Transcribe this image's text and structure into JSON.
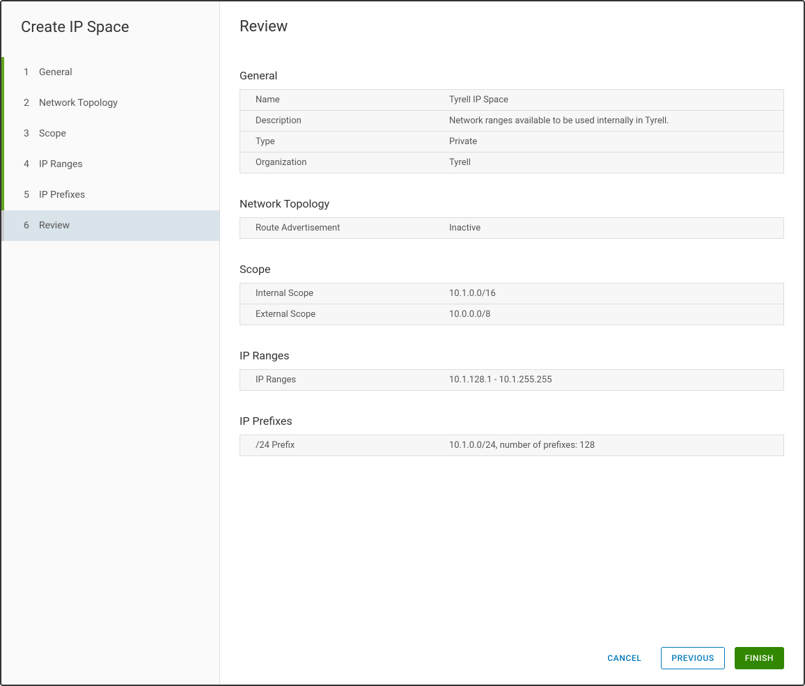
{
  "sidebar": {
    "title": "Create IP Space",
    "steps": [
      {
        "num": "1",
        "label": "General"
      },
      {
        "num": "2",
        "label": "Network Topology"
      },
      {
        "num": "3",
        "label": "Scope"
      },
      {
        "num": "4",
        "label": "IP Ranges"
      },
      {
        "num": "5",
        "label": "IP Prefixes"
      },
      {
        "num": "6",
        "label": "Review"
      }
    ]
  },
  "main": {
    "title": "Review",
    "sections": {
      "general": {
        "title": "General",
        "rows": [
          {
            "key": "Name",
            "value": "Tyrell IP Space"
          },
          {
            "key": "Description",
            "value": "Network ranges available to be used internally in Tyrell."
          },
          {
            "key": "Type",
            "value": "Private"
          },
          {
            "key": "Organization",
            "value": "Tyrell"
          }
        ]
      },
      "network_topology": {
        "title": "Network Topology",
        "rows": [
          {
            "key": "Route Advertisement",
            "value": "Inactive"
          }
        ]
      },
      "scope": {
        "title": "Scope",
        "rows": [
          {
            "key": "Internal Scope",
            "value": "10.1.0.0/16"
          },
          {
            "key": "External Scope",
            "value": "10.0.0.0/8"
          }
        ]
      },
      "ip_ranges": {
        "title": "IP Ranges",
        "rows": [
          {
            "key": "IP Ranges",
            "value": "10.1.128.1 - 10.1.255.255"
          }
        ]
      },
      "ip_prefixes": {
        "title": "IP Prefixes",
        "rows": [
          {
            "key": "/24 Prefix",
            "value": "10.1.0.0/24, number of prefixes: 128"
          }
        ]
      }
    }
  },
  "footer": {
    "cancel": "CANCEL",
    "previous": "PREVIOUS",
    "finish": "FINISH"
  }
}
